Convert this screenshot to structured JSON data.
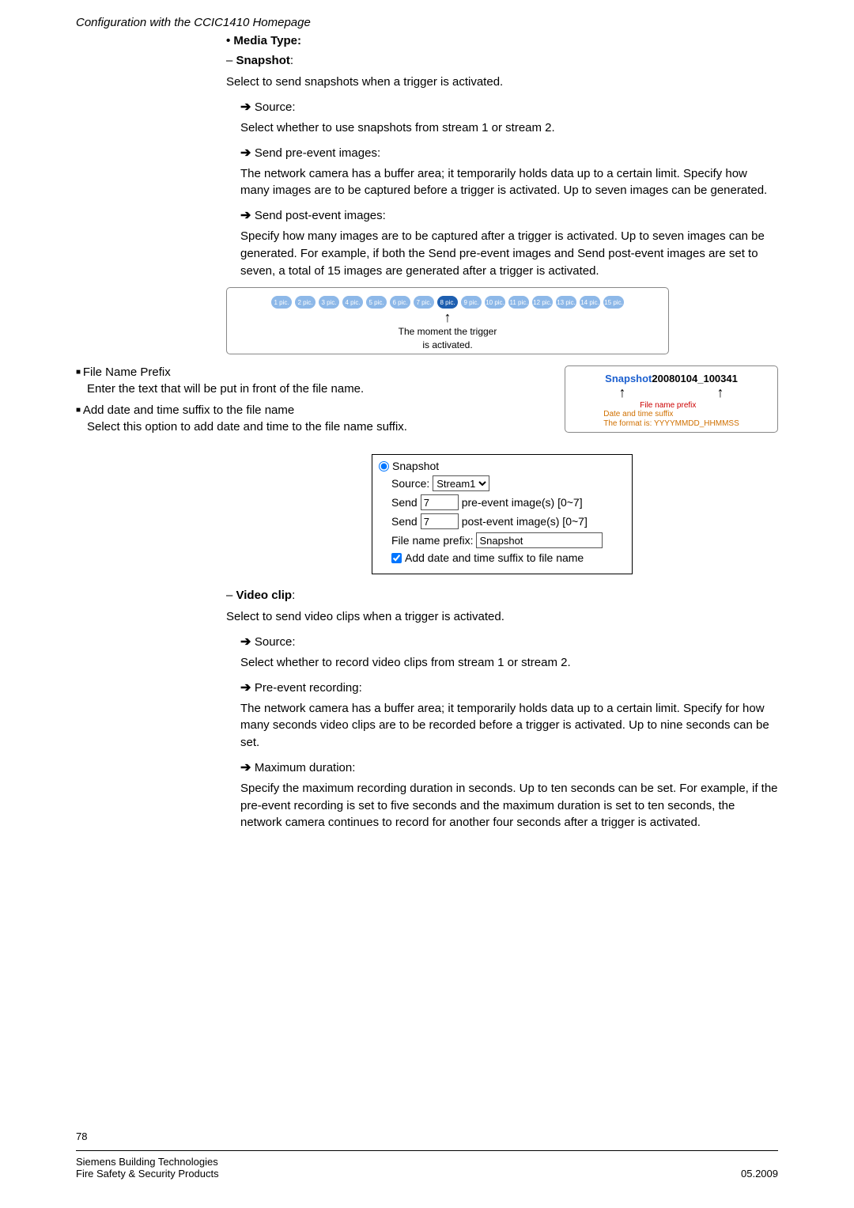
{
  "header": "Configuration with the CCIC1410 Homepage",
  "mediaType": "Media Type:",
  "snapshot": {
    "title": "Snapshot",
    "intro": "Select to send snapshots when a trigger is activated.",
    "source": {
      "label": "Source:",
      "desc": "Select whether to use snapshots from stream 1 or stream 2."
    },
    "preEvent": {
      "label": "Send pre-event images:",
      "desc": "The network camera has a buffer area; it temporarily holds data up to a certain limit. Specify how many images are to be captured before a trigger is activated. Up to seven images can be generated."
    },
    "postEvent": {
      "label": "Send post-event images:",
      "desc": "Specify how many images are to be captured after a trigger is activated. Up to seven images can be generated. For example, if both the Send pre-event images and Send post-event images are set to seven, a total of 15 images are generated after a trigger is activated."
    }
  },
  "diagram": {
    "pics": [
      "1 pic.",
      "2 pic.",
      "3 pic.",
      "4 pic.",
      "5 pic.",
      "6 pic.",
      "7 pic.",
      "8 pic.",
      "9 pic.",
      "10 pic.",
      "11 pic.",
      "12 pic.",
      "13 pic.",
      "14 pic.",
      "15 pic."
    ],
    "highlightIndex": 7,
    "caption1": "The moment the trigger",
    "caption2": "is activated."
  },
  "filePrefix": {
    "title": "File Name Prefix",
    "desc": "Enter the text that will be put in front of the file name."
  },
  "dateSuffix": {
    "title": "Add date and time suffix to the file name",
    "desc": "Select this option to add date and time to the file name suffix."
  },
  "prefixBox": {
    "blue": "Snapshot",
    "black": "20080104_100341",
    "leftLabel": "File name prefix",
    "rightLabel1": "Date and time suffix",
    "rightLabel2": "The format is: YYYYMMDD_HHMMSS"
  },
  "form": {
    "radioLabel": "Snapshot",
    "sourceLabel": "Source:",
    "sourceValue": "Stream1",
    "sendLabel": "Send",
    "preValue": "7",
    "preSuffix": "pre-event image(s) [0~7]",
    "postValue": "7",
    "postSuffix": "post-event image(s) [0~7]",
    "prefixLabel": "File name prefix:",
    "prefixValue": "Snapshot",
    "checkboxLabel": "Add date and time suffix to file name"
  },
  "videoClip": {
    "title": "Video clip",
    "intro": "Select to send video clips when a trigger is activated.",
    "source": {
      "label": "Source:",
      "desc": "Select whether to record video clips from stream 1 or stream 2."
    },
    "preRec": {
      "label": "Pre-event recording:",
      "desc": "The network camera has a buffer area; it temporarily holds data up to a certain limit. Specify for how many seconds video clips are to be recorded before a trigger is activated. Up to nine seconds can be set."
    },
    "maxDur": {
      "label": "Maximum duration:",
      "desc": "Specify the maximum recording duration in seconds. Up to ten seconds can be set. For example, if the pre-event recording is set to five seconds and the maximum duration is set to ten seconds, the network camera continues to record for another four seconds after a trigger is activated."
    }
  },
  "footer": {
    "page": "78",
    "left1": "Siemens Building Technologies",
    "left2": "Fire Safety & Security Products",
    "right": "05.2009"
  }
}
